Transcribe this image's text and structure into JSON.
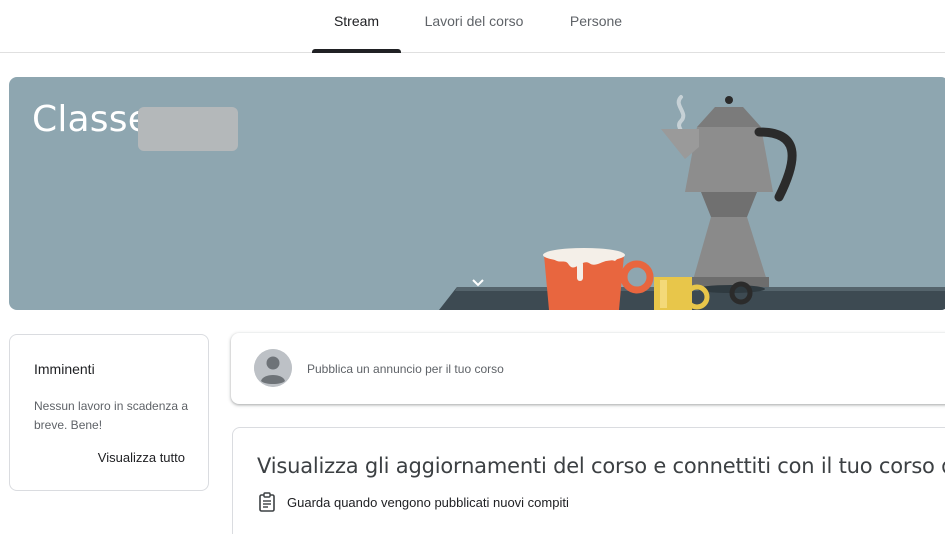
{
  "tabs": [
    {
      "label": "Stream",
      "active": true
    },
    {
      "label": "Lavori del corso",
      "active": false
    },
    {
      "label": "Persone",
      "active": false
    }
  ],
  "banner": {
    "title": "Classe",
    "background_color": "#8ea6b0",
    "illustration": "coffee-moka-pot-and-cups"
  },
  "upcoming": {
    "title": "Imminenti",
    "text": "Nessun lavoro in scadenza a breve. Bene!",
    "link_label": "Visualizza tutto"
  },
  "announce": {
    "placeholder": "Pubblica un annuncio per il tuo corso"
  },
  "info_card": {
    "title": "Visualizza gli aggiornamenti del corso e connettiti con il tuo corso qui",
    "item": "Guarda quando vengono pubblicati nuovi compiti",
    "item_icon": "assignment-icon"
  },
  "colors": {
    "tab_active": "#202124",
    "text_secondary": "#5f6368",
    "card_border": "#dadce0"
  }
}
